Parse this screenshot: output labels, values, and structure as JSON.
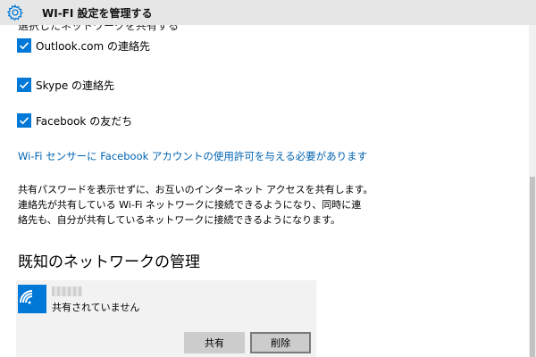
{
  "window": {
    "title": "WI-FI 設定を管理する",
    "icon": "gear-icon"
  },
  "contacts_section": {
    "partial_heading": "選択したネットワークを共有する",
    "options": [
      {
        "label": "Outlook.com の連絡先",
        "checked": true
      },
      {
        "label": "Skype の連絡先",
        "checked": true
      },
      {
        "label": "Facebook の友だち",
        "checked": true
      }
    ]
  },
  "facebook_link": "Wi-Fi センサーに Facebook アカウントの使用許可を与える必要があります",
  "description": {
    "line1": "共有パスワードを表示せずに、お互いのインターネット アクセスを共有します。",
    "line2": "連絡先が共有している Wi-Fi ネットワークに接続できるようになり、同時に連",
    "line3": "絡先も、自分が共有しているネットワークに接続できるようになります。"
  },
  "known_networks": {
    "heading": "既知のネットワークの管理",
    "network": {
      "icon": "wifi-icon",
      "status": "共有されていません"
    },
    "buttons": {
      "share": "共有",
      "delete": "削除"
    }
  },
  "colors": {
    "accent": "#0078d7",
    "link": "#0063b1",
    "titlebar": "#e6e6e6",
    "card": "#f2f2f2",
    "button": "#cccccc"
  }
}
